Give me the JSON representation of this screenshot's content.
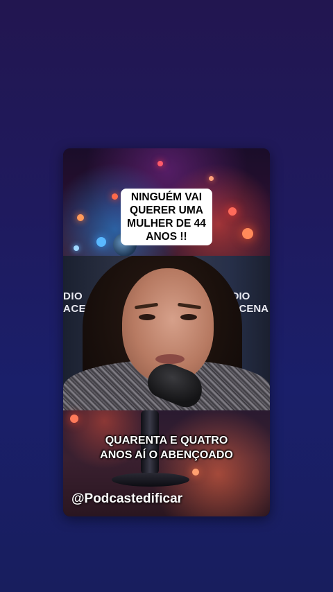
{
  "overlay": {
    "top_caption": [
      "NINGUÉM VAI",
      "QUERER UMA",
      "MULHER DE 44",
      "ANOS !!"
    ]
  },
  "video": {
    "wall_text_left": [
      "DIO",
      "ACEN"
    ],
    "wall_text_right": [
      "DIO",
      "ACENA"
    ]
  },
  "subtitle": [
    "QUARENTA E QUATRO",
    "ANOS AÍ O ABENÇOADO"
  ],
  "watermark": {
    "handle": "@Podcastedificar"
  }
}
